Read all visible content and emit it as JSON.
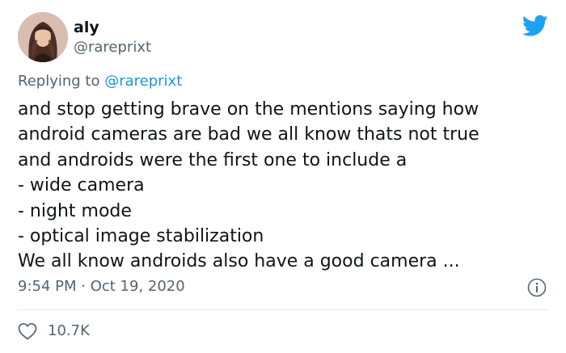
{
  "author": {
    "display_name": "aly",
    "handle": "@rareprixt",
    "avatar_icon": "avatar-photo"
  },
  "reply": {
    "prefix": "Replying to ",
    "mention": "@rareprixt"
  },
  "tweet": {
    "lines": [
      "and stop getting brave on the mentions saying how",
      "android cameras are bad we all know thats not true",
      "and androids were the first one to include a",
      "- wide camera",
      "- night mode",
      "- optical image stabilization",
      "We all know androids also have a good camera ..."
    ],
    "timestamp": "9:54 PM · Oct 19, 2020"
  },
  "actions": {
    "like_icon": "heart-icon",
    "like_count": "10.7K",
    "info_icon": "info-icon"
  },
  "colors": {
    "brand": "#1da1f2",
    "mention": "#1b95e0",
    "secondary_text": "#536471",
    "primary_text": "#0f1419",
    "divider": "#e6ecf0"
  }
}
